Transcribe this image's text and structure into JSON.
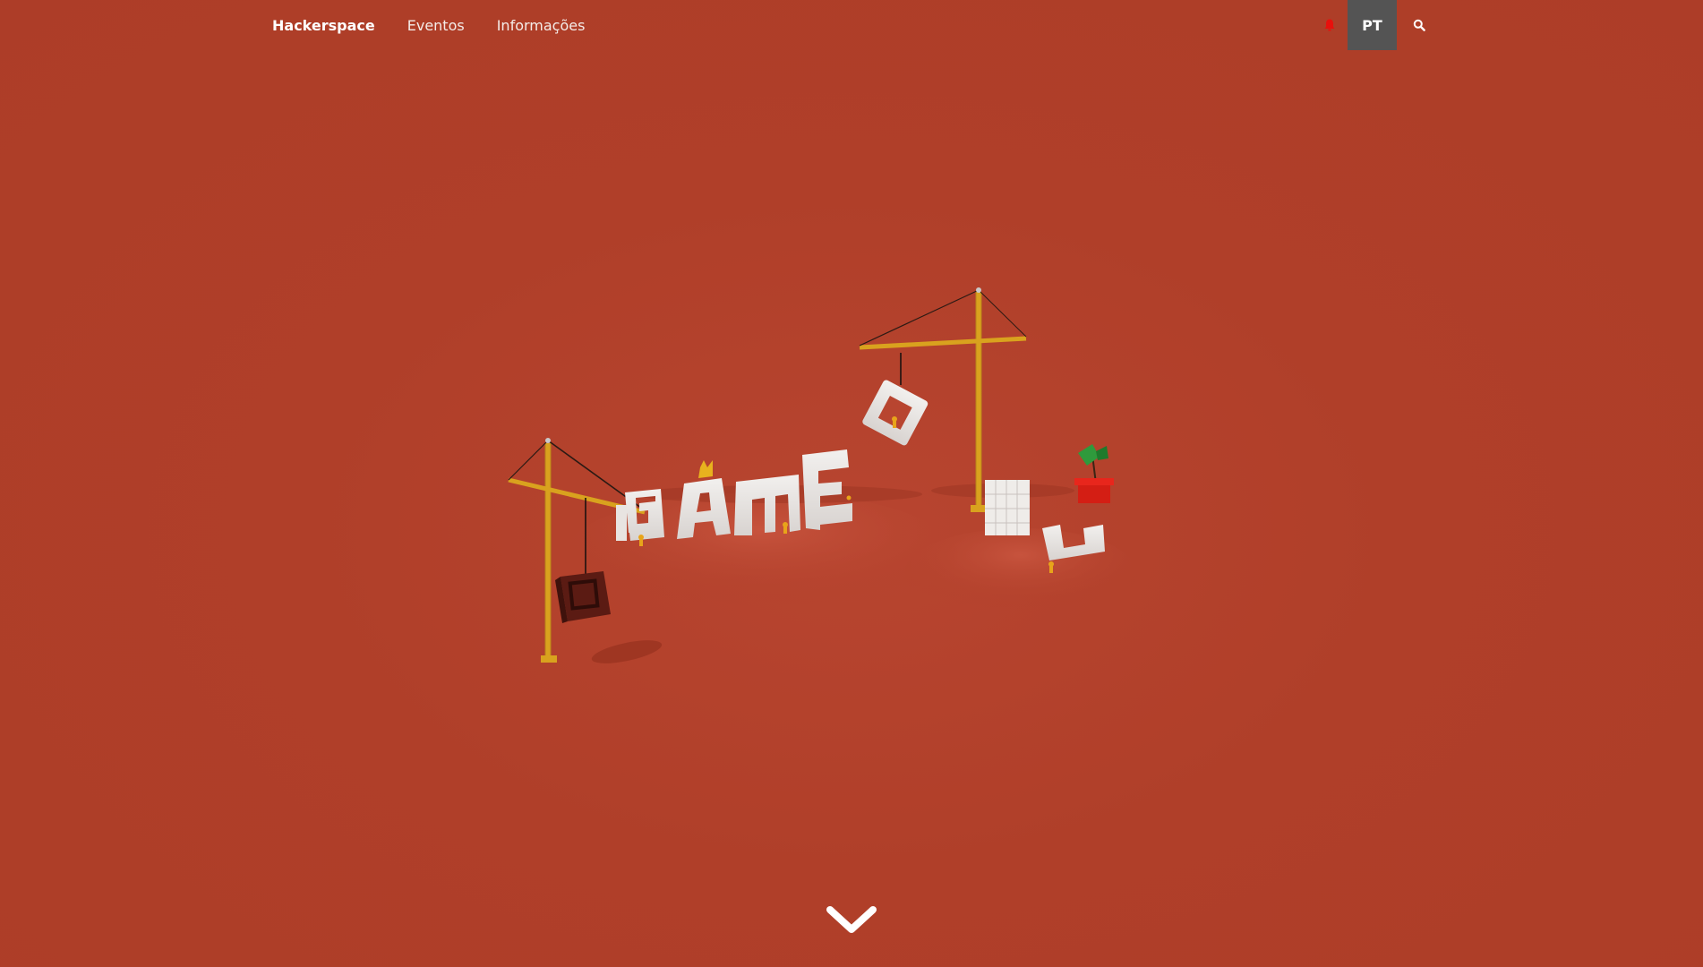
{
  "nav": {
    "brand": "Hackerspace",
    "links": [
      "Eventos",
      "Informações"
    ],
    "lang": "PT",
    "bell_icon": "bell-icon",
    "search_icon": "search-icon"
  },
  "hero": {
    "illustration": "game-construction-illustration",
    "word": "GAME"
  },
  "scroll": {
    "icon": "chevron-down-icon"
  },
  "colors": {
    "background": "#b03f29",
    "lang_button": "#545454",
    "bell": "#e8100c",
    "crane": "#d9a21e",
    "letters": "#e9e6e4"
  }
}
